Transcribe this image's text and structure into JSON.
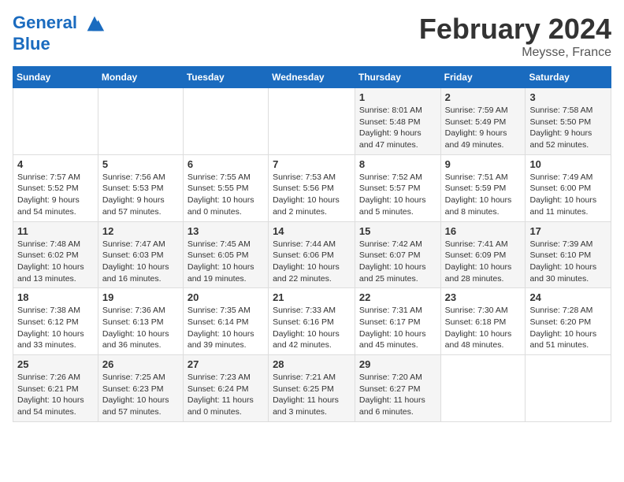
{
  "logo": {
    "line1": "General",
    "line2": "Blue"
  },
  "title": "February 2024",
  "location": "Meysse, France",
  "days_of_week": [
    "Sunday",
    "Monday",
    "Tuesday",
    "Wednesday",
    "Thursday",
    "Friday",
    "Saturday"
  ],
  "weeks": [
    [
      {
        "day": "",
        "info": ""
      },
      {
        "day": "",
        "info": ""
      },
      {
        "day": "",
        "info": ""
      },
      {
        "day": "",
        "info": ""
      },
      {
        "day": "1",
        "info": "Sunrise: 8:01 AM\nSunset: 5:48 PM\nDaylight: 9 hours\nand 47 minutes."
      },
      {
        "day": "2",
        "info": "Sunrise: 7:59 AM\nSunset: 5:49 PM\nDaylight: 9 hours\nand 49 minutes."
      },
      {
        "day": "3",
        "info": "Sunrise: 7:58 AM\nSunset: 5:50 PM\nDaylight: 9 hours\nand 52 minutes."
      }
    ],
    [
      {
        "day": "4",
        "info": "Sunrise: 7:57 AM\nSunset: 5:52 PM\nDaylight: 9 hours\nand 54 minutes."
      },
      {
        "day": "5",
        "info": "Sunrise: 7:56 AM\nSunset: 5:53 PM\nDaylight: 9 hours\nand 57 minutes."
      },
      {
        "day": "6",
        "info": "Sunrise: 7:55 AM\nSunset: 5:55 PM\nDaylight: 10 hours\nand 0 minutes."
      },
      {
        "day": "7",
        "info": "Sunrise: 7:53 AM\nSunset: 5:56 PM\nDaylight: 10 hours\nand 2 minutes."
      },
      {
        "day": "8",
        "info": "Sunrise: 7:52 AM\nSunset: 5:57 PM\nDaylight: 10 hours\nand 5 minutes."
      },
      {
        "day": "9",
        "info": "Sunrise: 7:51 AM\nSunset: 5:59 PM\nDaylight: 10 hours\nand 8 minutes."
      },
      {
        "day": "10",
        "info": "Sunrise: 7:49 AM\nSunset: 6:00 PM\nDaylight: 10 hours\nand 11 minutes."
      }
    ],
    [
      {
        "day": "11",
        "info": "Sunrise: 7:48 AM\nSunset: 6:02 PM\nDaylight: 10 hours\nand 13 minutes."
      },
      {
        "day": "12",
        "info": "Sunrise: 7:47 AM\nSunset: 6:03 PM\nDaylight: 10 hours\nand 16 minutes."
      },
      {
        "day": "13",
        "info": "Sunrise: 7:45 AM\nSunset: 6:05 PM\nDaylight: 10 hours\nand 19 minutes."
      },
      {
        "day": "14",
        "info": "Sunrise: 7:44 AM\nSunset: 6:06 PM\nDaylight: 10 hours\nand 22 minutes."
      },
      {
        "day": "15",
        "info": "Sunrise: 7:42 AM\nSunset: 6:07 PM\nDaylight: 10 hours\nand 25 minutes."
      },
      {
        "day": "16",
        "info": "Sunrise: 7:41 AM\nSunset: 6:09 PM\nDaylight: 10 hours\nand 28 minutes."
      },
      {
        "day": "17",
        "info": "Sunrise: 7:39 AM\nSunset: 6:10 PM\nDaylight: 10 hours\nand 30 minutes."
      }
    ],
    [
      {
        "day": "18",
        "info": "Sunrise: 7:38 AM\nSunset: 6:12 PM\nDaylight: 10 hours\nand 33 minutes."
      },
      {
        "day": "19",
        "info": "Sunrise: 7:36 AM\nSunset: 6:13 PM\nDaylight: 10 hours\nand 36 minutes."
      },
      {
        "day": "20",
        "info": "Sunrise: 7:35 AM\nSunset: 6:14 PM\nDaylight: 10 hours\nand 39 minutes."
      },
      {
        "day": "21",
        "info": "Sunrise: 7:33 AM\nSunset: 6:16 PM\nDaylight: 10 hours\nand 42 minutes."
      },
      {
        "day": "22",
        "info": "Sunrise: 7:31 AM\nSunset: 6:17 PM\nDaylight: 10 hours\nand 45 minutes."
      },
      {
        "day": "23",
        "info": "Sunrise: 7:30 AM\nSunset: 6:18 PM\nDaylight: 10 hours\nand 48 minutes."
      },
      {
        "day": "24",
        "info": "Sunrise: 7:28 AM\nSunset: 6:20 PM\nDaylight: 10 hours\nand 51 minutes."
      }
    ],
    [
      {
        "day": "25",
        "info": "Sunrise: 7:26 AM\nSunset: 6:21 PM\nDaylight: 10 hours\nand 54 minutes."
      },
      {
        "day": "26",
        "info": "Sunrise: 7:25 AM\nSunset: 6:23 PM\nDaylight: 10 hours\nand 57 minutes."
      },
      {
        "day": "27",
        "info": "Sunrise: 7:23 AM\nSunset: 6:24 PM\nDaylight: 11 hours\nand 0 minutes."
      },
      {
        "day": "28",
        "info": "Sunrise: 7:21 AM\nSunset: 6:25 PM\nDaylight: 11 hours\nand 3 minutes."
      },
      {
        "day": "29",
        "info": "Sunrise: 7:20 AM\nSunset: 6:27 PM\nDaylight: 11 hours\nand 6 minutes."
      },
      {
        "day": "",
        "info": ""
      },
      {
        "day": "",
        "info": ""
      }
    ]
  ]
}
